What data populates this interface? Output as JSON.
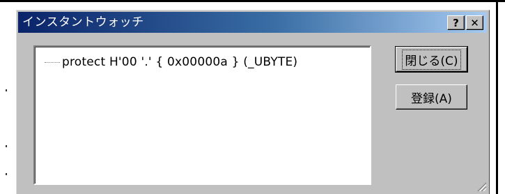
{
  "window": {
    "title": "インスタントウォッチ",
    "help_label": "?",
    "close_label": "✕"
  },
  "watch": {
    "items": [
      {
        "text": "protect H'00 '.' { 0x00000a } (_UBYTE)"
      }
    ]
  },
  "buttons": {
    "close_dialog": "閉じる(C)",
    "register": "登録(A)"
  },
  "colors": {
    "title_gradient_start": "#0a246a",
    "title_gradient_end": "#a6caf0",
    "dialog_face": "#c0c0c0"
  }
}
